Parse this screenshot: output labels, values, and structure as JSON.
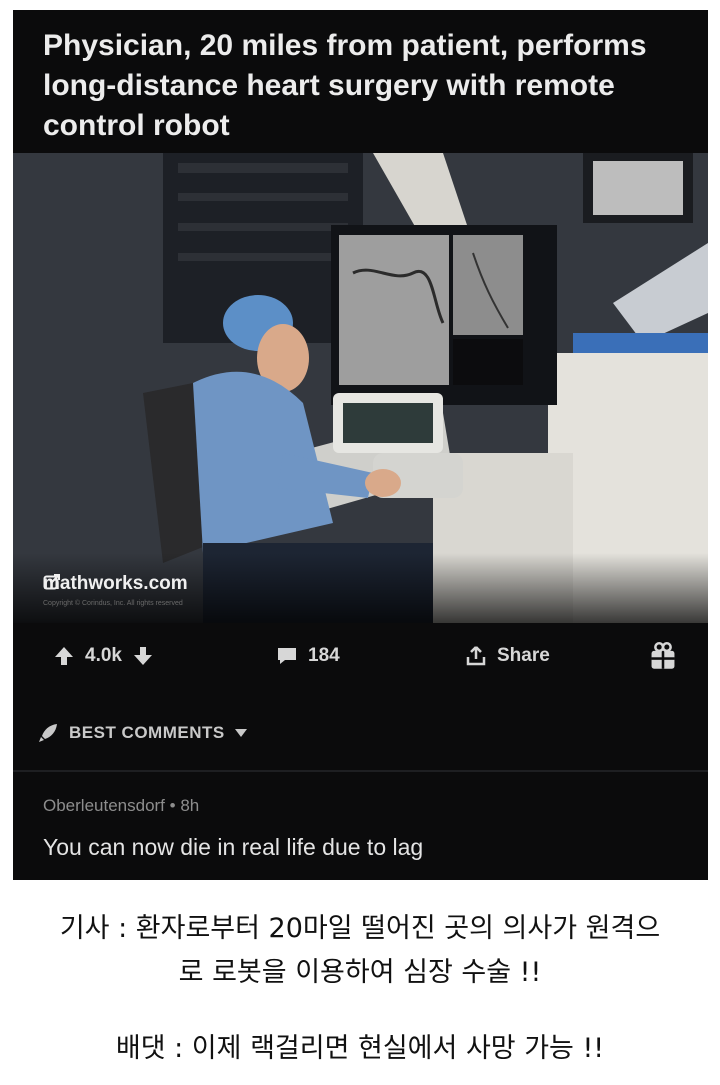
{
  "post": {
    "title": "Physician, 20 miles from patient, performs long-distance heart surgery with remote control robot",
    "link_domain": "mathworks.com",
    "copyright": "Copyright © Corindus, Inc. All rights reserved",
    "upvotes": "4.0k",
    "comments": "184",
    "share_label": "Share",
    "icons": {
      "upvote": "arrow-up-icon",
      "downvote": "arrow-down-icon",
      "comment": "comment-bubble-icon",
      "share": "share-icon",
      "gift": "gift-icon",
      "external": "external-link-icon",
      "sort": "rocket-icon",
      "dropdown": "caret-down-icon"
    }
  },
  "sort": {
    "label": "BEST COMMENTS"
  },
  "comment": {
    "author": "Oberleutensdorf",
    "age": "8h",
    "separator": "•",
    "body": "You can now die in real life due to lag"
  },
  "captions": {
    "line1": "기사 : 환자로부터 20마일 떨어진 곳의 의사가 원격으",
    "line2": "로 로봇을 이용하여 심장 수술 !!",
    "line3": "배댓 : 이제 랙걸리면 현실에서 사망 가능 !!"
  },
  "colors": {
    "background": "#0b0b0c",
    "text": "#e8e8e8",
    "muted": "#8d8d8d"
  }
}
